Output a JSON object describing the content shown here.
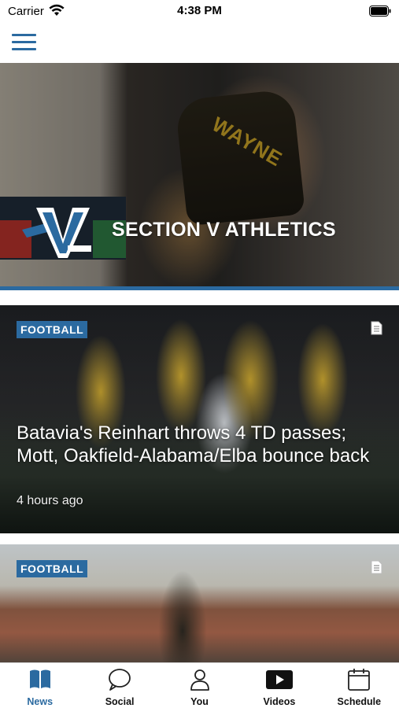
{
  "status_bar": {
    "carrier": "Carrier",
    "time": "4:38 PM"
  },
  "hero": {
    "title": "SECTION V ATHLETICS",
    "singlet_text": "WAYNE"
  },
  "cards": [
    {
      "category": "FOOTBALL",
      "headline": "Batavia's Reinhart throws 4 TD passes; Mott, Oakfield-Alabama/Elba bounce back",
      "time": "4 hours ago",
      "type_icon": "article-icon"
    },
    {
      "category": "FOOTBALL",
      "type_icon": "article-icon"
    }
  ],
  "tabs": [
    {
      "label": "News",
      "icon": "book-icon",
      "active": true
    },
    {
      "label": "Social",
      "icon": "speech-bubble-icon",
      "active": false
    },
    {
      "label": "You",
      "icon": "person-icon",
      "active": false
    },
    {
      "label": "Videos",
      "icon": "play-icon",
      "active": false
    },
    {
      "label": "Schedule",
      "icon": "calendar-icon",
      "active": false
    }
  ],
  "colors": {
    "accent": "#2b6aa0",
    "background": "#ffffff"
  }
}
